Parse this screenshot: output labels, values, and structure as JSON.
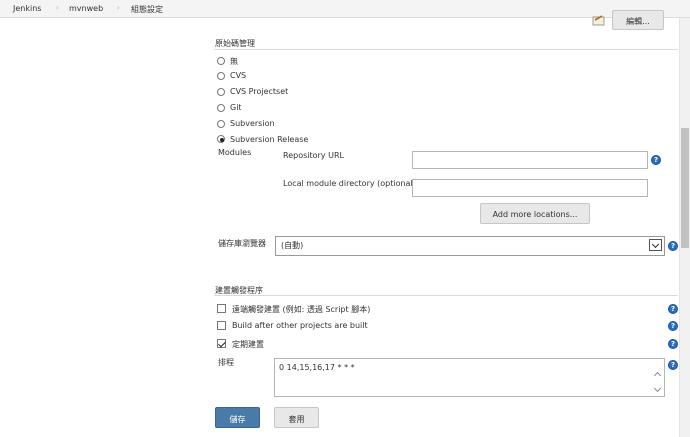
{
  "breadcrumb": [
    "Jenkins",
    "mvnweb",
    "組態設定"
  ],
  "header_button_label": "編輯...",
  "scm": {
    "title": "原始碼管理",
    "options": [
      "無",
      "CVS",
      "CVS Projectset",
      "Git",
      "Subversion",
      "Subversion Release"
    ],
    "selected": "Subversion Release",
    "modules_label": "Modules",
    "repository_url_label": "Repository URL",
    "repository_url_value": "",
    "local_dir_label": "Local module directory (optional)",
    "local_dir_value": "",
    "add_locations_label": "Add more locations..."
  },
  "repo_browser": {
    "label": "儲存庫瀏覽器",
    "selected": "(自動)"
  },
  "triggers": {
    "title": "建置觸發程序",
    "items": [
      {
        "label": "遠端觸發建置 (例如: 透過 Script 腳本)",
        "checked": false
      },
      {
        "label": "Build after other projects are built",
        "checked": false
      },
      {
        "label": "定期建置",
        "checked": true
      }
    ],
    "schedule_label": "排程",
    "schedule_value": "0 14,15,16,17 * * *"
  },
  "footer": {
    "save_label": "儲存",
    "apply_label": "套用"
  },
  "colors": {
    "help_icon": "#2a6fc1",
    "save_button": "#4a7aa8"
  }
}
